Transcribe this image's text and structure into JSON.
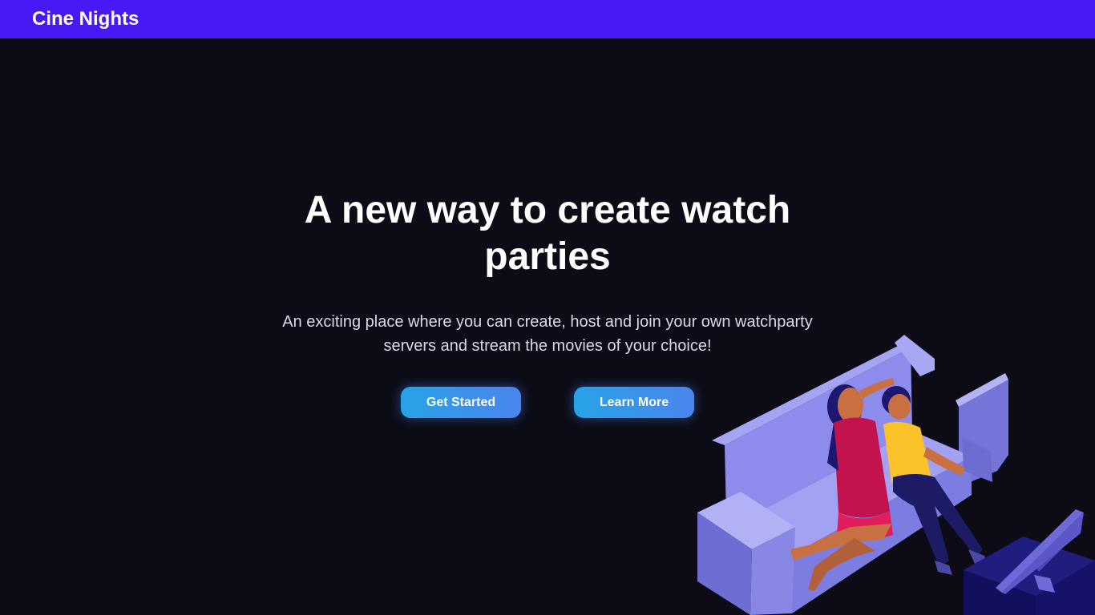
{
  "navbar": {
    "brand": "Cine Nights"
  },
  "hero": {
    "title": "A new way to create watch parties",
    "subtitle": "An exciting place where you can create, host and join your own watchparty servers and stream the movies of your choice!",
    "primary_button": "Get Started",
    "secondary_button": "Learn More"
  },
  "illustration": {
    "icon": "couple-on-sofa-watching-tv-illustration"
  },
  "colors": {
    "navbar": "#4a17f5",
    "background": "#0d0c16",
    "button_start": "#27a3e6",
    "button_end": "#4a85ee",
    "sofa": "#8f8eea"
  }
}
